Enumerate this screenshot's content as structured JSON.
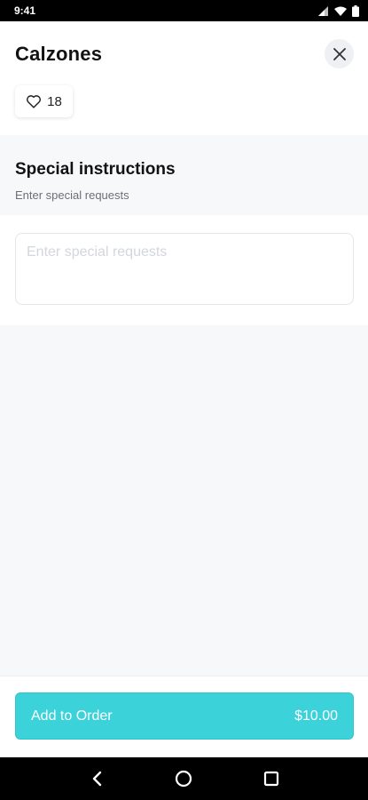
{
  "status_bar": {
    "time": "9:41"
  },
  "header": {
    "title": "Calzones",
    "like_count": "18"
  },
  "special_instructions": {
    "title": "Special instructions",
    "subtitle": "Enter special requests",
    "placeholder": "Enter special requests",
    "value": ""
  },
  "order": {
    "button_label": "Add to Order",
    "price": "$10.00"
  },
  "colors": {
    "accent": "#3cd2d9",
    "background": "#f7f8fa"
  },
  "icons": {
    "close": "close-icon",
    "like": "heart-icon",
    "nav_back": "back-icon",
    "nav_home": "home-icon",
    "nav_recent": "recent-apps-icon"
  }
}
